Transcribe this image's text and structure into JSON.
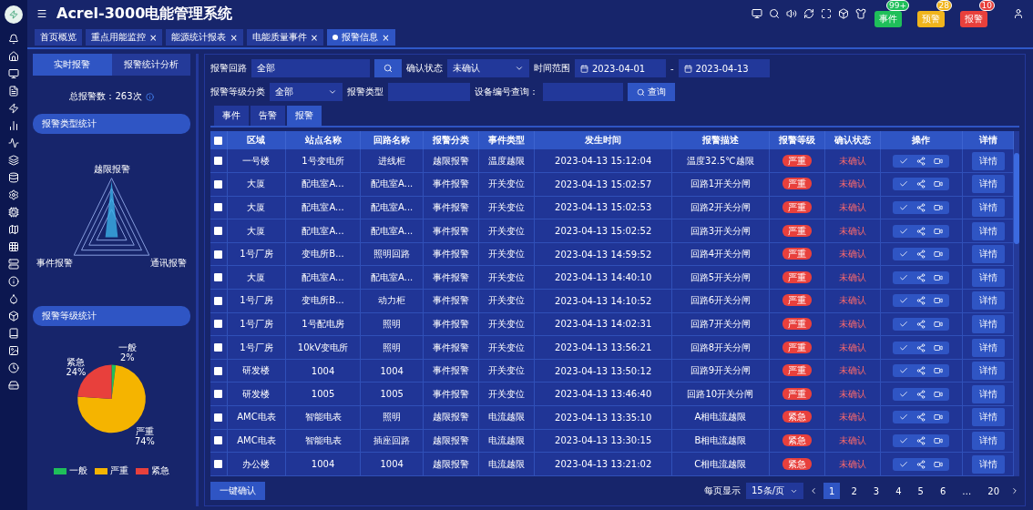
{
  "header": {
    "title": "Acrel-3000电能管理系统",
    "alerts": [
      {
        "label": "事件",
        "count": "99+",
        "color": "#1fbf5a"
      },
      {
        "label": "预警",
        "count": "28",
        "color": "#f0b41c"
      },
      {
        "label": "报警",
        "count": "10",
        "color": "#e8403c"
      }
    ]
  },
  "tabs": [
    {
      "label": "首页概览",
      "selected": false
    },
    {
      "label": "重点用能监控",
      "close": "×",
      "selected": false
    },
    {
      "label": "能源统计报表",
      "close": "×",
      "selected": false
    },
    {
      "label": "电能质量事件",
      "close": "×",
      "selected": false
    },
    {
      "label": "报警信息",
      "close": "×",
      "selected": true
    }
  ],
  "left_panel": {
    "tabs": [
      {
        "label": "实时报警",
        "selected": true
      },
      {
        "label": "报警统计分析",
        "selected": false
      }
    ],
    "total": "总报警数：263次",
    "type_section": {
      "title": "报警类型统计",
      "axes": [
        "越限报警",
        "事件报警",
        "通讯报警"
      ]
    },
    "level_section": {
      "chart_data": {
        "type": "pie",
        "title": "报警等级统计",
        "categories": [
          "一般",
          "严重",
          "紧急"
        ],
        "values": [
          2,
          74,
          24
        ],
        "colors": [
          "#1fbf5a",
          "#f5b400",
          "#e8403c"
        ],
        "value_labels": [
          "2%",
          "74%",
          "24%"
        ]
      }
    }
  },
  "filters": {
    "circuit_label": "报警回路",
    "circuit_value": "全部",
    "confirm_label": "确认状态",
    "confirm_value": "未确认",
    "time_label": "时间范围",
    "date_from": "2023-04-01",
    "range_separator": "-",
    "date_to": "2023-04-13",
    "level_label": "报警等级分类",
    "level_value": "全部",
    "type_label": "报警类型",
    "device_label": "设备编号查询：",
    "query_button": "查询"
  },
  "sub_tabs": [
    {
      "label": "事件",
      "selected": false
    },
    {
      "label": "告警",
      "selected": false
    },
    {
      "label": "报警",
      "selected": true
    }
  ],
  "table": {
    "columns": [
      "区域",
      "站点名称",
      "回路名称",
      "报警分类",
      "事件类型",
      "发生时间",
      "报警描述",
      "报警等级",
      "确认状态",
      "操作",
      "详情"
    ],
    "select_all_checked": false,
    "rows": [
      {
        "checked": false,
        "cells": [
          "一号楼",
          "1号变电所",
          "进线柜",
          "越限报警",
          "温度越限",
          "2023-04-13 15:12:04",
          "温度32.5℃越限",
          "严重",
          "未确认"
        ],
        "detail": "详情"
      },
      {
        "checked": false,
        "cells": [
          "大厦",
          "配电室A...",
          "配电室A...",
          "事件报警",
          "开关变位",
          "2023-04-13 15:02:57",
          "回路1开关分闸",
          "严重",
          "未确认"
        ],
        "detail": "详情"
      },
      {
        "checked": false,
        "cells": [
          "大厦",
          "配电室A...",
          "配电室A...",
          "事件报警",
          "开关变位",
          "2023-04-13 15:02:53",
          "回路2开关分闸",
          "严重",
          "未确认"
        ],
        "detail": "详情"
      },
      {
        "checked": false,
        "cells": [
          "大厦",
          "配电室A...",
          "配电室A...",
          "事件报警",
          "开关变位",
          "2023-04-13 15:02:52",
          "回路3开关分闸",
          "严重",
          "未确认"
        ],
        "detail": "详情"
      },
      {
        "checked": false,
        "cells": [
          "1号厂房",
          "变电所B...",
          "照明回路",
          "事件报警",
          "开关变位",
          "2023-04-13 14:59:52",
          "回路4开关分闸",
          "严重",
          "未确认"
        ],
        "detail": "详情"
      },
      {
        "checked": false,
        "cells": [
          "大厦",
          "配电室A...",
          "配电室A...",
          "事件报警",
          "开关变位",
          "2023-04-13 14:40:10",
          "回路5开关分闸",
          "严重",
          "未确认"
        ],
        "detail": "详情"
      },
      {
        "checked": false,
        "cells": [
          "1号厂房",
          "变电所B...",
          "动力柜",
          "事件报警",
          "开关变位",
          "2023-04-13 14:10:52",
          "回路6开关分闸",
          "严重",
          "未确认"
        ],
        "detail": "详情"
      },
      {
        "checked": false,
        "cells": [
          "1号厂房",
          "1号配电房",
          "照明",
          "事件报警",
          "开关变位",
          "2023-04-13 14:02:31",
          "回路7开关分闸",
          "严重",
          "未确认"
        ],
        "detail": "详情"
      },
      {
        "checked": false,
        "cells": [
          "1号厂房",
          "10kV变电所",
          "照明",
          "事件报警",
          "开关变位",
          "2023-04-13 13:56:21",
          "回路8开关分闸",
          "严重",
          "未确认"
        ],
        "detail": "详情"
      },
      {
        "checked": false,
        "cells": [
          "研发楼",
          "1004",
          "1004",
          "事件报警",
          "开关变位",
          "2023-04-13 13:50:12",
          "回路9开关分闸",
          "严重",
          "未确认"
        ],
        "detail": "详情"
      },
      {
        "checked": false,
        "cells": [
          "研发楼",
          "1005",
          "1005",
          "事件报警",
          "开关变位",
          "2023-04-13 13:46:40",
          "回路10开关分闸",
          "严重",
          "未确认"
        ],
        "detail": "详情"
      },
      {
        "checked": false,
        "cells": [
          "AMC电表",
          "智能电表",
          "照明",
          "越限报警",
          "电流越限",
          "2023-04-13 13:35:10",
          "A相电流越限",
          "紧急",
          "未确认"
        ],
        "detail": "详情"
      },
      {
        "checked": false,
        "cells": [
          "AMC电表",
          "智能电表",
          "插座回路",
          "越限报警",
          "电流越限",
          "2023-04-13 13:30:15",
          "B相电流越限",
          "紧急",
          "未确认"
        ],
        "detail": "详情"
      },
      {
        "checked": false,
        "cells": [
          "办公楼",
          "1004",
          "1004",
          "越限报警",
          "电流越限",
          "2023-04-13 13:21:02",
          "C相电流越限",
          "紧急",
          "未确认"
        ],
        "detail": "详情"
      }
    ]
  },
  "footer": {
    "confirm_all": "一键确认",
    "page_size_label": "每页显示",
    "page_size": "15条/页",
    "pages": [
      {
        "label": "1",
        "selected": true
      },
      {
        "label": "2",
        "selected": false
      },
      {
        "label": "3",
        "selected": false
      },
      {
        "label": "4",
        "selected": false
      },
      {
        "label": "5",
        "selected": false
      },
      {
        "label": "6",
        "selected": false
      },
      {
        "label": "…",
        "selected": false
      },
      {
        "label": "20",
        "selected": false
      }
    ]
  }
}
